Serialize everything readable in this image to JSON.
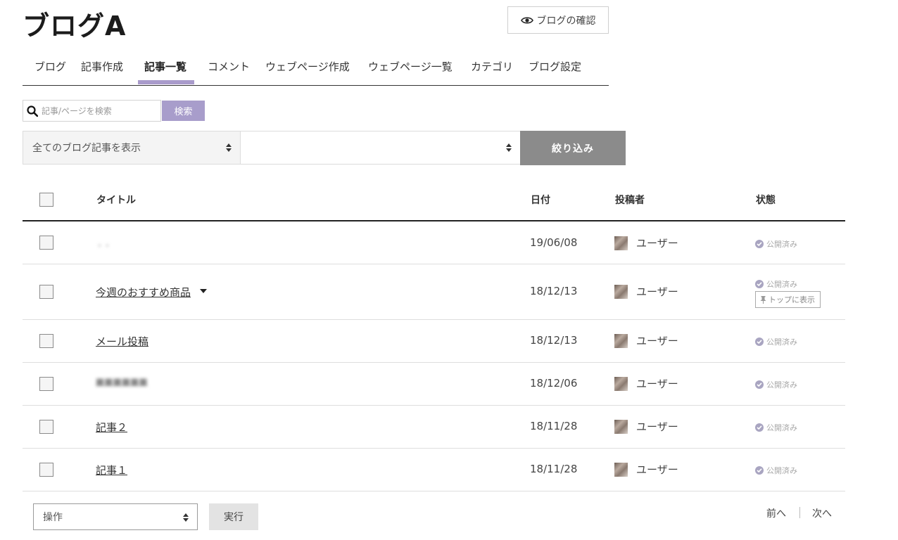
{
  "header": {
    "blog_title": "ブログA",
    "preview_button": "ブログの確認"
  },
  "nav": {
    "tabs": [
      {
        "label": "ブログ"
      },
      {
        "label": "記事作成"
      },
      {
        "label": "記事一覧",
        "active": true
      },
      {
        "label": "コメント"
      },
      {
        "label": "ウェブページ作成"
      },
      {
        "label": "ウェブページ一覧"
      },
      {
        "label": "カテゴリ"
      },
      {
        "label": "ブログ設定"
      }
    ]
  },
  "search": {
    "placeholder": "記事/ページを検索",
    "button": "検索"
  },
  "filters": {
    "select1_value": "全てのブログ記事を表示",
    "select2_value": "",
    "filter_button": "絞り込み"
  },
  "table": {
    "headers": {
      "title": "タイトル",
      "date": "日付",
      "author": "投稿者",
      "status": "状態"
    },
    "rows": [
      {
        "title": "・・",
        "date": "19/06/08",
        "author": "ユーザー",
        "status": "公開済み",
        "blurred": true
      },
      {
        "title": "今週のおすすめ商品",
        "date": "18/12/13",
        "author": "ユーザー",
        "status": "公開済み",
        "pin": "トップに表示",
        "dropdown": true
      },
      {
        "title": "メール投稿",
        "date": "18/12/13",
        "author": "ユーザー",
        "status": "公開済み"
      },
      {
        "title": "■■■■■■",
        "date": "18/12/06",
        "author": "ユーザー",
        "status": "公開済み",
        "blurred": true
      },
      {
        "title": "記事２",
        "date": "18/11/28",
        "author": "ユーザー",
        "status": "公開済み"
      },
      {
        "title": "記事１",
        "date": "18/11/28",
        "author": "ユーザー",
        "status": "公開済み"
      }
    ]
  },
  "footer": {
    "operation_select": "操作",
    "execute_button": "実行",
    "prev": "前へ",
    "next": "次へ"
  },
  "colors": {
    "accent": "#a99bcb",
    "filter_button": "#8b8b8b",
    "status_icon": "#a9a5c1"
  }
}
